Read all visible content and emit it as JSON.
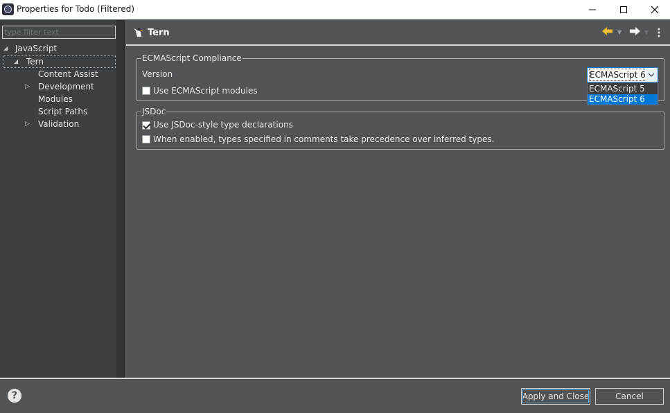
{
  "window": {
    "title": "Properties for Todo (Filtered)",
    "controls": [
      "minimize",
      "maximize",
      "close"
    ]
  },
  "filter": {
    "placeholder": "type filter text",
    "value": ""
  },
  "tree": [
    {
      "label": "JavaScript",
      "expanded": true
    },
    {
      "label": "Tern",
      "expanded": true,
      "selected": true
    },
    {
      "label": "Content Assist"
    },
    {
      "label": "Development",
      "expandable": true
    },
    {
      "label": "Modules"
    },
    {
      "label": "Script Paths"
    },
    {
      "label": "Validation",
      "expandable": true
    }
  ],
  "page": {
    "title": "Tern",
    "icon": "tern-bird-icon"
  },
  "ecma": {
    "legend": "ECMAScript Compliance",
    "version_label": "Version",
    "version_value": "ECMAScript 6",
    "version_options": [
      "ECMAScript 5",
      "ECMAScript 6"
    ],
    "modules_label": "Use ECMAScript modules",
    "modules_checked": false
  },
  "jsdoc": {
    "legend": "JSDoc",
    "type_decl_label": "Use JSDoc-style type declarations",
    "type_decl_checked": true,
    "precedence_label": "When enabled, types specified in comments take precedence over inferred types.",
    "precedence_checked": false
  },
  "buttons": {
    "apply_close": "Apply and Close",
    "cancel": "Cancel",
    "help": "?"
  },
  "colors": {
    "background": "#505457",
    "tree_background": "#3c3f41",
    "selection": "#0078d7",
    "nav_back": "#f0c040"
  }
}
